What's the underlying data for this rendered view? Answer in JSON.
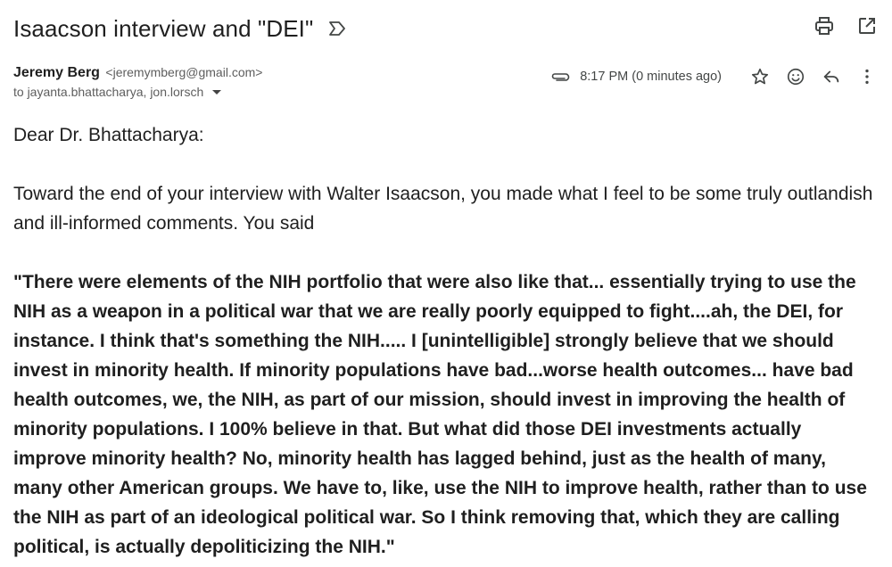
{
  "email": {
    "subject": "Isaacson interview and \"DEI\"",
    "sender_name": "Jeremy Berg",
    "sender_email": "<jeremymberg@gmail.com>",
    "recipients": "to jayanta.bhattacharya, jon.lorsch",
    "timestamp": "8:17 PM (0 minutes ago)",
    "greeting": "Dear Dr. Bhattacharya:",
    "intro": "Toward the end of your interview with Walter Isaacson, you made what I feel to be some truly outlandish and ill-informed comments. You said",
    "quote": "\"There were elements of the NIH portfolio that were also like that... essentially trying to use the NIH as a weapon in a political war that we are really poorly equipped to fight....ah, the DEI, for instance. I think that's something the NIH..... I [unintelligible] strongly believe that we should invest in minority health. If minority populations have bad...worse health outcomes... have bad health outcomes, we, the NIH, as part of our mission, should invest in improving the health of minority populations. I 100% believe in that. But what did those DEI investments actually improve minority health? No, minority health has lagged behind, just as the health of many, many other American groups. We have to, like, use the NIH to improve health, rather than to use the NIH as part of an ideological political war. So I think removing that, which they are calling political, is actually depoliticizing the NIH.\""
  },
  "icons": {
    "label": "label-icon",
    "print": "print-icon",
    "open_new_window": "open-in-new-window-icon",
    "attachment": "paperclip-icon",
    "star": "star-icon",
    "emoji": "emoji-reaction-icon",
    "reply": "reply-icon",
    "more": "more-vert-icon",
    "recipient_details": "chevron-down-icon"
  }
}
